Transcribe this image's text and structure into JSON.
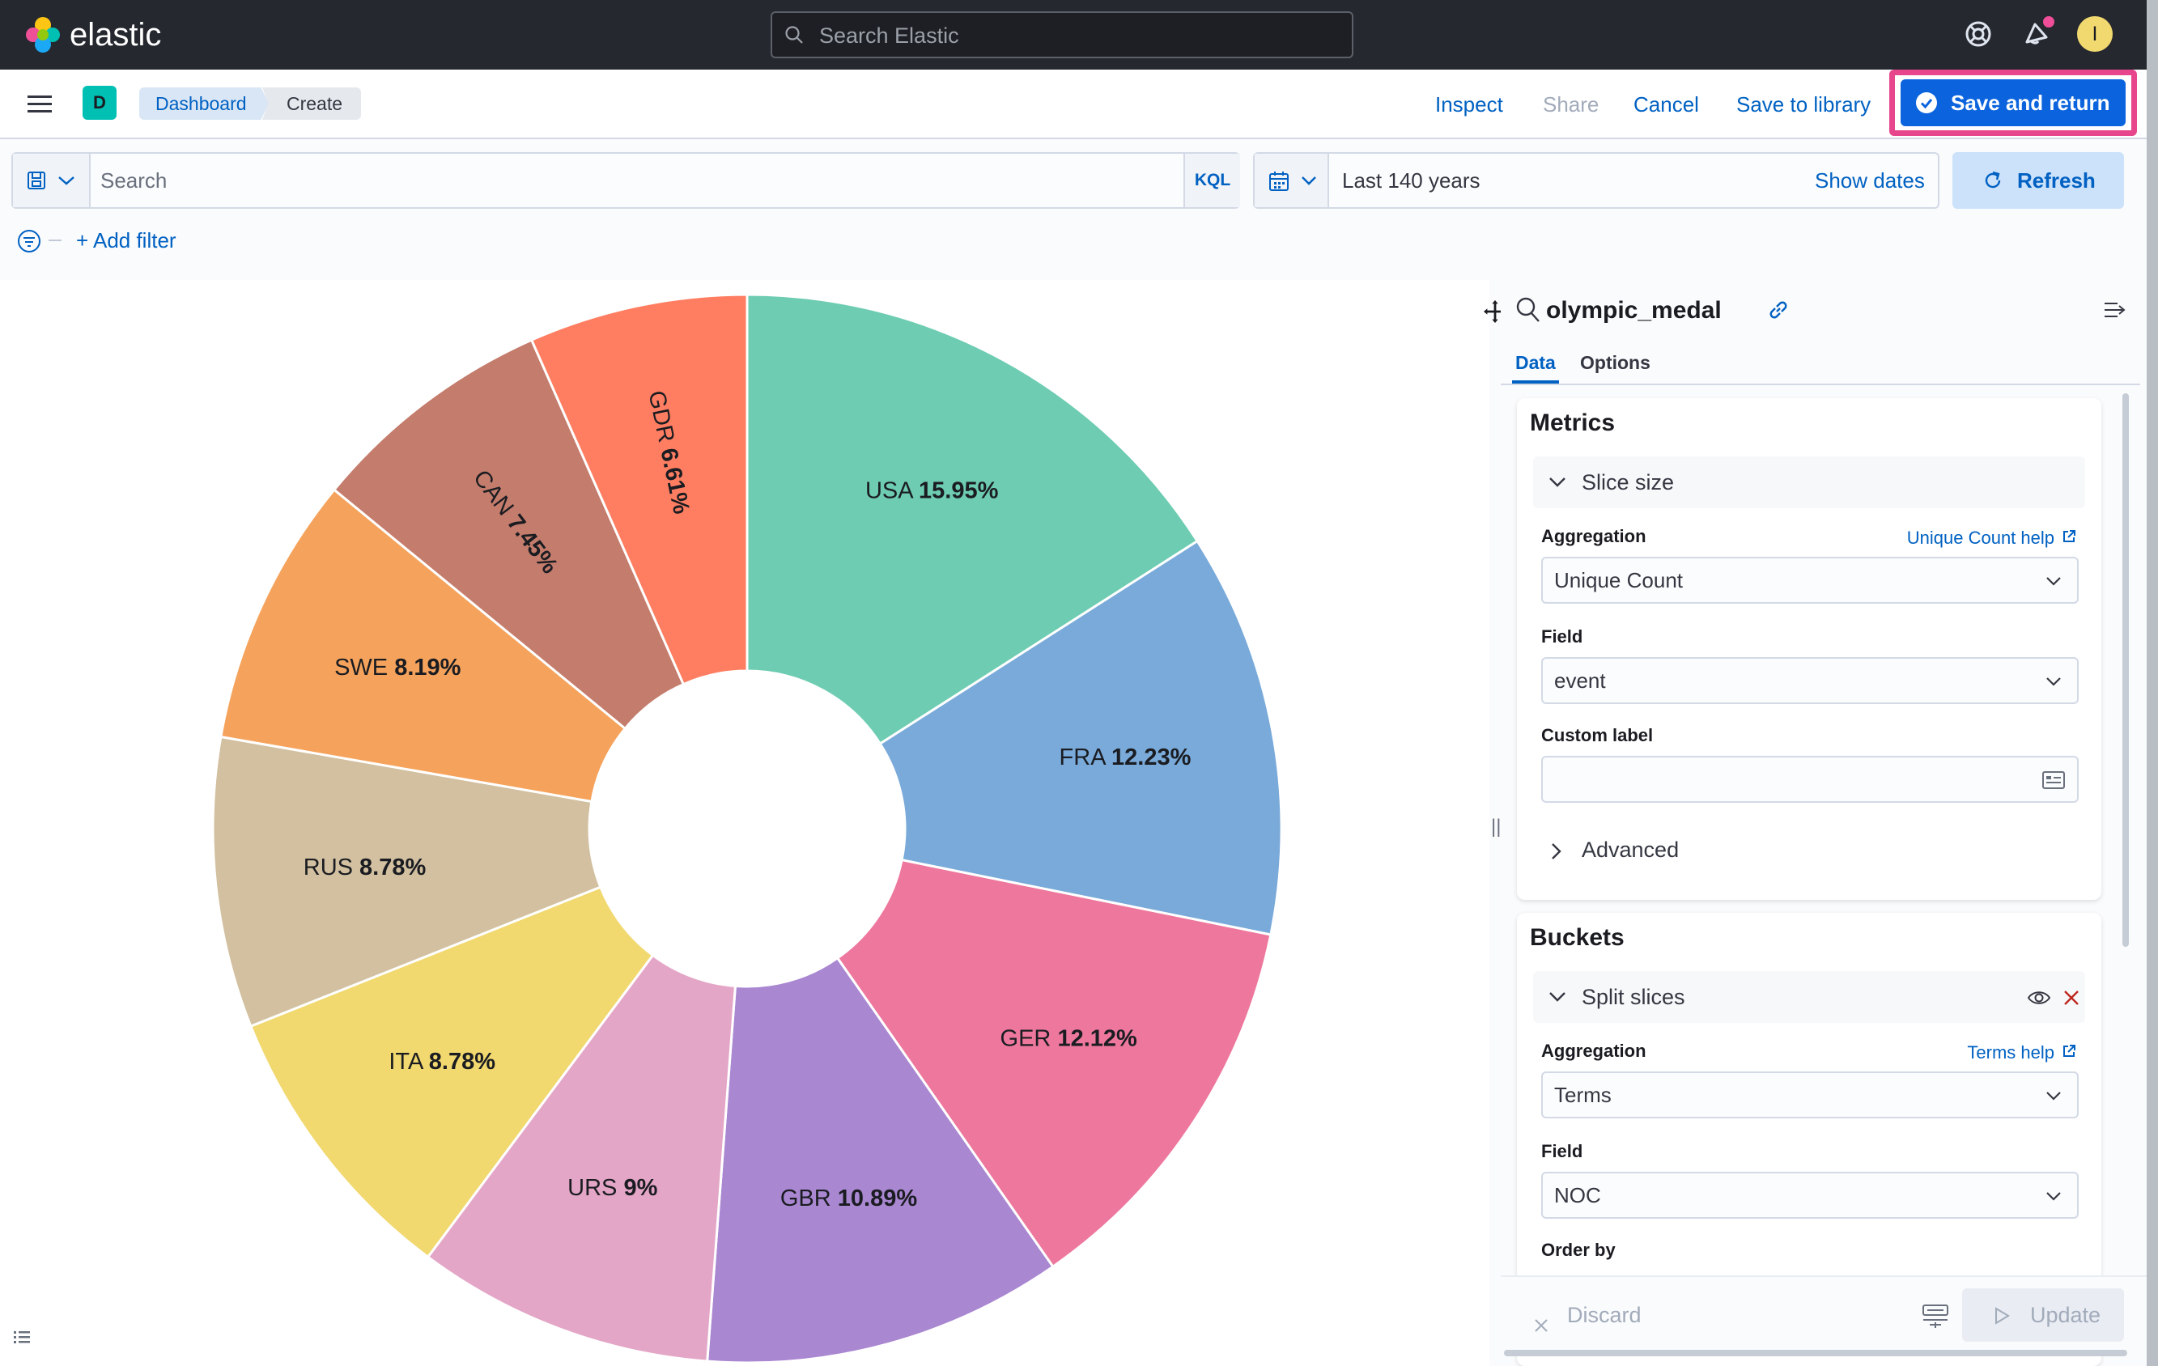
{
  "header": {
    "brand": "elastic",
    "search_placeholder": "Search Elastic",
    "avatar_initial": "I"
  },
  "app_bar": {
    "space_initial": "D",
    "breadcrumbs": [
      "Dashboard",
      "Create"
    ],
    "actions": {
      "inspect": "Inspect",
      "share": "Share",
      "cancel": "Cancel",
      "save_to_library": "Save to library",
      "save_and_return": "Save and return"
    }
  },
  "query_bar": {
    "placeholder": "Search",
    "language": "KQL",
    "date_range": "Last 140 years",
    "show_dates": "Show dates",
    "refresh": "Refresh",
    "add_filter": "+ Add filter"
  },
  "sidebar": {
    "index_pattern": "olympic_medal",
    "tabs": [
      "Data",
      "Options"
    ],
    "metrics": {
      "title": "Metrics",
      "accordion": "Slice size",
      "aggregation_label": "Aggregation",
      "aggregation_help": "Unique Count help",
      "aggregation_value": "Unique Count",
      "field_label": "Field",
      "field_value": "event",
      "custom_label_label": "Custom label",
      "custom_label_value": "",
      "advanced": "Advanced"
    },
    "buckets": {
      "title": "Buckets",
      "accordion": "Split slices",
      "aggregation_label": "Aggregation",
      "aggregation_help": "Terms help",
      "aggregation_value": "Terms",
      "field_label": "Field",
      "field_value": "NOC",
      "order_by_label": "Order by"
    },
    "footer": {
      "discard": "Discard",
      "update": "Update"
    }
  },
  "chart_data": {
    "type": "pie",
    "donut": true,
    "categories": [
      "USA",
      "FRA",
      "GER",
      "GBR",
      "URS",
      "ITA",
      "RUS",
      "SWE",
      "CAN",
      "GDR"
    ],
    "values": [
      15.95,
      12.23,
      12.12,
      10.89,
      9,
      8.78,
      8.78,
      8.19,
      7.45,
      6.61
    ],
    "labels": [
      "15.95%",
      "12.23%",
      "12.12%",
      "10.89%",
      "9%",
      "8.78%",
      "8.78%",
      "8.19%",
      "7.45%",
      "6.61%"
    ],
    "colors": [
      "#6dccb1",
      "#79aad9",
      "#ee789d",
      "#a987d1",
      "#e4a6c7",
      "#f1d86f",
      "#d2c0a0",
      "#f5a35c",
      "#c47c6c",
      "#ff7e62"
    ]
  }
}
